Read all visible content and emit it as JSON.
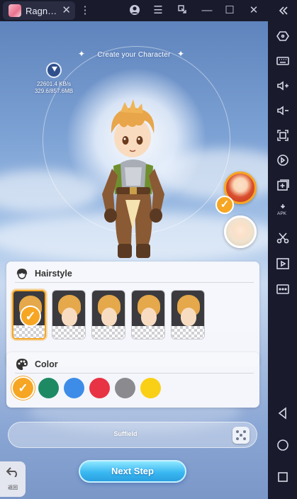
{
  "emulator": {
    "tab_title": "Ragn…",
    "sidebar_icons": [
      "expand-collapse-icon",
      "keyboard-control-icon",
      "keyboard-icon",
      "volume-up-icon",
      "volume-down-icon",
      "fullscreen-icon",
      "rotate-icon",
      "add-app-icon",
      "apk-install-icon",
      "screenshot-scissors-icon",
      "record-video-icon",
      "more-icon",
      "back-nav-icon",
      "home-nav-icon",
      "recents-nav-icon"
    ],
    "apk_label": "APK"
  },
  "game": {
    "header_title": "Create your Character",
    "download_speed": "22601.4 KB/s",
    "download_progress": "329.6/857.6MB",
    "hairstyle": {
      "label": "Hairstyle",
      "selected_index": 0,
      "options": [
        "hairstyle-1",
        "hairstyle-2",
        "hairstyle-3",
        "hairstyle-4",
        "hairstyle-5"
      ]
    },
    "color": {
      "label": "Color",
      "selected_index": 0,
      "options": [
        "#f6a623",
        "#1d8a64",
        "#3d8de8",
        "#e83344",
        "#8b8b8f",
        "#f9d016"
      ]
    },
    "character_name": "Suffield",
    "next_button": "Next Step",
    "back_label": "返回",
    "check_glyph": "✓"
  }
}
